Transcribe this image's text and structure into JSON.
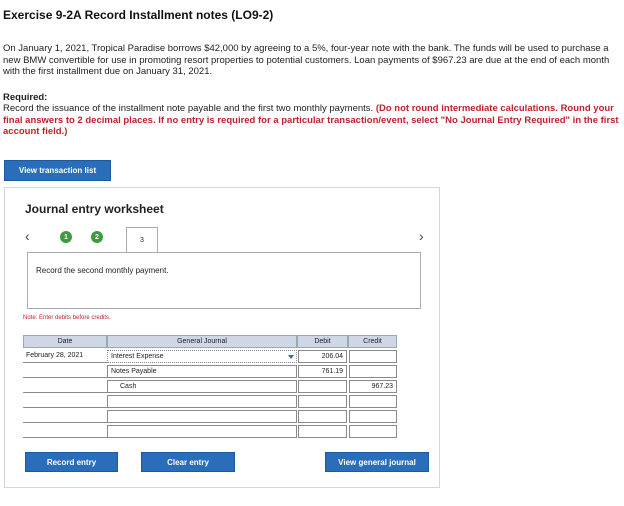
{
  "header": {
    "title": "Exercise 9-2A Record Installment notes (LO9-2)"
  },
  "problem": {
    "intro": "On January 1, 2021, Tropical Paradise borrows $42,000 by agreeing to a 5%, four-year note with the bank. The funds will be used to purchase a new BMW convertible for use in promoting resort properties to potential customers. Loan payments of $967.23 are due at the end of each month with the first installment due on January 31, 2021.",
    "required_heading": "Required:",
    "required_text": "Record the issuance of the installment note payable and the first two monthly payments. ",
    "required_red": "(Do not round intermediate calculations. Round your final answers to 2 decimal places. If no entry is required for a particular transaction/event, select \"No Journal Entry Required\" in the first account field.)"
  },
  "buttons": {
    "view_transaction_list": "View transaction list",
    "record_entry": "Record entry",
    "clear_entry": "Clear entry",
    "view_general_journal": "View general journal"
  },
  "worksheet": {
    "title": "Journal entry worksheet",
    "prev_icon": "chevron-left-icon",
    "next_icon": "chevron-right-icon",
    "steps": [
      "1",
      "2",
      "3"
    ],
    "active_step": "3",
    "instruction": "Record the second monthly payment.",
    "note": "Note: Enter debits before credits.",
    "columns": {
      "date": "Date",
      "journal": "General Journal",
      "debit": "Debit",
      "credit": "Credit"
    },
    "rows": [
      {
        "date": "February 28, 2021",
        "account": "Interest Expense",
        "debit": "206.04",
        "credit": ""
      },
      {
        "date": "",
        "account": "Notes Payable",
        "debit": "761.19",
        "credit": ""
      },
      {
        "date": "",
        "account": "Cash",
        "debit": "",
        "credit": "967.23"
      },
      {
        "date": "",
        "account": "",
        "debit": "",
        "credit": ""
      },
      {
        "date": "",
        "account": "",
        "debit": "",
        "credit": ""
      },
      {
        "date": "",
        "account": "",
        "debit": "",
        "credit": ""
      }
    ]
  },
  "colors": {
    "button_blue": "#2a6ebb",
    "step_green": "#3f9b3f",
    "note_red": "#c0212c",
    "header_bg": "#cfd7e6"
  }
}
